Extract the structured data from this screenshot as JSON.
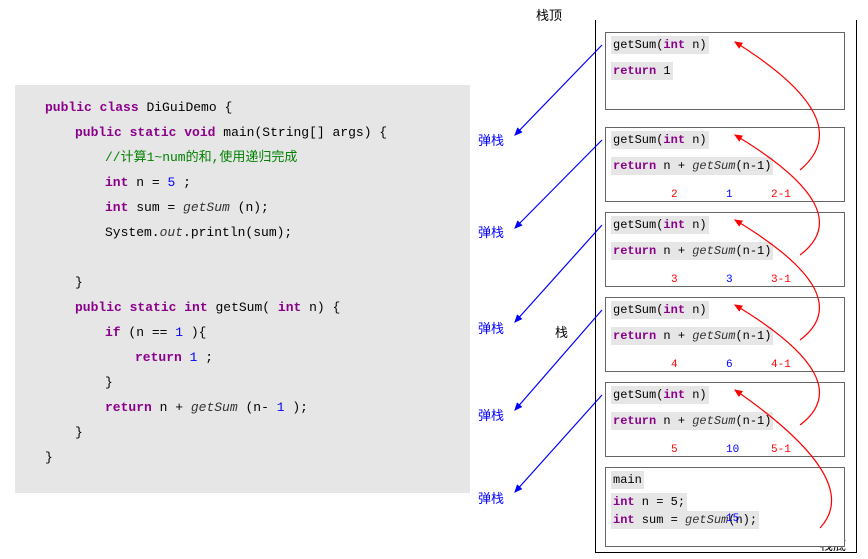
{
  "code": {
    "l1_public": "public",
    "l1_class": "class",
    "l1_name": " DiGuiDemo {",
    "l2_public": "public",
    "l2_static": "static",
    "l2_void": "void",
    "l2_rest": " main(String[] args) {",
    "l3_comment": "//计算1~num的和,使用递归完成",
    "l4_int": "int",
    "l4_rest": " n = ",
    "l4_num": "5",
    "l4_end": ";",
    "l5_int": "int",
    "l5_rest": " sum = ",
    "l5_call": "getSum",
    "l5_end": "(n);",
    "l6": "System.",
    "l6_out": "out",
    "l6_end": ".println(sum);",
    "l7": "}",
    "l8_public": "public",
    "l8_static": "static",
    "l8_int": "int",
    "l8_rest": " getSum(",
    "l8_int2": "int",
    "l8_end": " n) {",
    "l9_if": "if",
    "l9_rest": "(n == ",
    "l9_num": "1",
    "l9_end": "){",
    "l10_return": "return",
    "l10_num": " 1",
    "l10_end": ";",
    "l11": "}",
    "l12_return": "return",
    "l12_rest": " n + ",
    "l12_call": "getSum",
    "l12_end": "(n-",
    "l12_num": "1",
    "l12_end2": ");",
    "l13": "}",
    "l14": "}"
  },
  "labels": {
    "stack_top": "栈顶",
    "stack_mid": "栈",
    "stack_bottom": "栈底",
    "pop": "弹栈"
  },
  "frames": [
    {
      "sig_pre": "getSum(",
      "sig_int": "int",
      "sig_post": " n)",
      "ret_kw": "return",
      "ret_expr": " 1",
      "ann_n": "",
      "ann_res": "",
      "ann_arg": ""
    },
    {
      "sig_pre": "getSum(",
      "sig_int": "int",
      "sig_post": " n)",
      "ret_kw": "return",
      "ret_expr": " n + ",
      "ret_call": "getSum",
      "ret_end": "(n-1)",
      "ann_n": "2",
      "ann_res": "1",
      "ann_arg": "2-1"
    },
    {
      "sig_pre": "getSum(",
      "sig_int": "int",
      "sig_post": " n)",
      "ret_kw": "return",
      "ret_expr": " n + ",
      "ret_call": "getSum",
      "ret_end": "(n-1)",
      "ann_n": "3",
      "ann_res": "3",
      "ann_arg": "3-1"
    },
    {
      "sig_pre": "getSum(",
      "sig_int": "int",
      "sig_post": " n)",
      "ret_kw": "return",
      "ret_expr": " n + ",
      "ret_call": "getSum",
      "ret_end": "(n-1)",
      "ann_n": "4",
      "ann_res": "6",
      "ann_arg": "4-1"
    },
    {
      "sig_pre": "getSum(",
      "sig_int": "int",
      "sig_post": " n)",
      "ret_kw": "return",
      "ret_expr": " n + ",
      "ret_call": "getSum",
      "ret_end": "(n-1)",
      "ann_n": "5",
      "ann_res": "10",
      "ann_arg": "5-1"
    }
  ],
  "main_frame": {
    "title": "main",
    "l1_int": "int",
    "l1_rest": " n = 5;",
    "l2_int": "int",
    "l2_rest": " sum = ",
    "l2_call": "getSum",
    "l2_end": "(n);",
    "ann_res": "15"
  }
}
